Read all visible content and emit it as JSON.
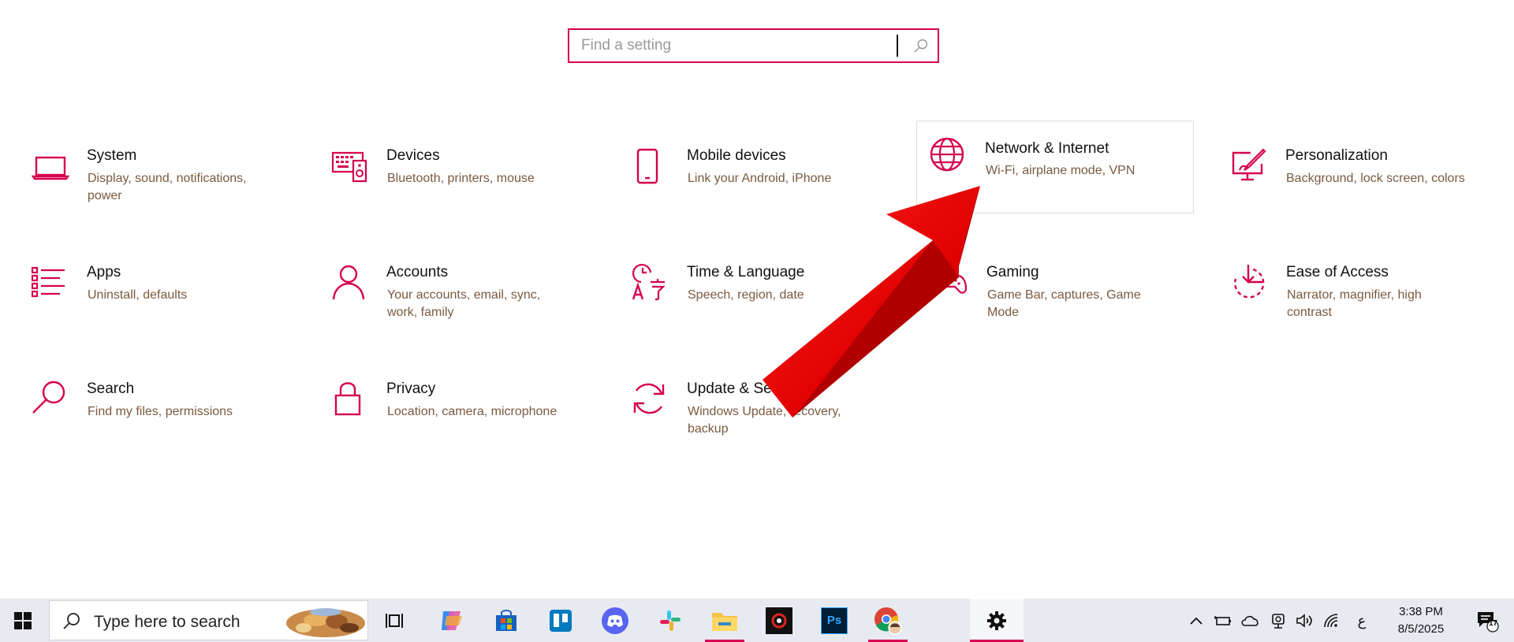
{
  "search": {
    "placeholder": "Find a setting"
  },
  "tiles": [
    {
      "name": "System",
      "desc": "Display, sound, notifications, power",
      "icon": "laptop-icon"
    },
    {
      "name": "Devices",
      "desc": "Bluetooth, printers, mouse",
      "icon": "keyboard-speaker-icon"
    },
    {
      "name": "Mobile devices",
      "desc": "Link your Android, iPhone",
      "icon": "phone-icon"
    },
    {
      "name": "Network & Internet",
      "desc": "Wi-Fi, airplane mode, VPN",
      "icon": "globe-icon"
    },
    {
      "name": "Personalization",
      "desc": "Background, lock screen, colors",
      "icon": "paint-monitor-icon"
    },
    {
      "name": "Apps",
      "desc": "Uninstall, defaults",
      "icon": "apps-list-icon"
    },
    {
      "name": "Accounts",
      "desc": "Your accounts, email, sync, work, family",
      "icon": "person-icon"
    },
    {
      "name": "Time & Language",
      "desc": "Speech, region, date",
      "icon": "time-language-icon"
    },
    {
      "name": "Gaming",
      "desc": "Game Bar, captures, Game Mode",
      "icon": "gamepad-icon"
    },
    {
      "name": "Ease of Access",
      "desc": "Narrator, magnifier, high contrast",
      "icon": "ease-of-access-icon"
    },
    {
      "name": "Search",
      "desc": "Find my files, permissions",
      "icon": "magnifier-icon"
    },
    {
      "name": "Privacy",
      "desc": "Location, camera, microphone",
      "icon": "lock-icon"
    },
    {
      "name": "Update & Security",
      "desc": "Windows Update, recovery, backup",
      "icon": "sync-icon"
    }
  ],
  "accent_color": "#d6004f",
  "taskbar": {
    "search_placeholder": "Type here to search",
    "time": "3:38 PM",
    "date": "8/5/2025",
    "language": "ع",
    "notification_count": "17",
    "ps_label": "Ps"
  }
}
